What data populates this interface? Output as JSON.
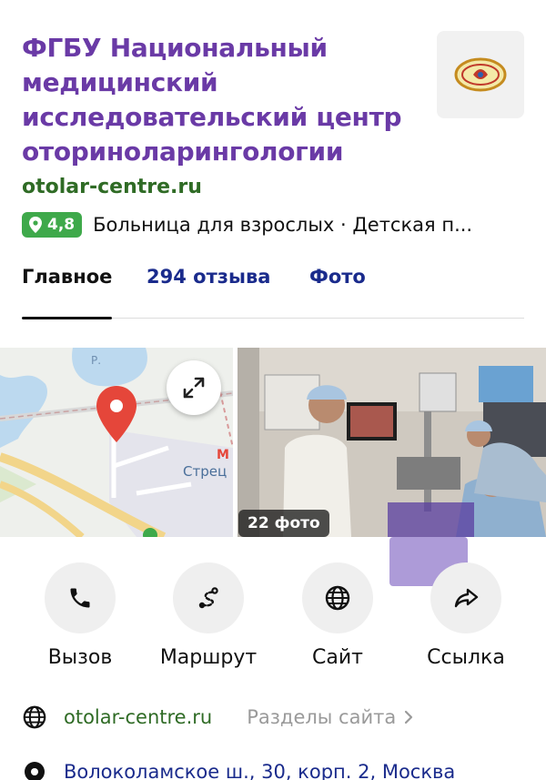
{
  "org": {
    "title_lines": [
      "ФГБУ Национальный",
      "медицинский",
      "исследовательский центр",
      "оториноларингологии"
    ],
    "website": "otolar-centre.ru",
    "rating": "4,8",
    "categories": "Больница для взрослых · Детская п..."
  },
  "tabs": [
    {
      "label": "Главное",
      "active": true
    },
    {
      "label": "294 отзыва",
      "active": false
    },
    {
      "label": "Фото",
      "active": false
    }
  ],
  "map": {
    "street_label": "Стрец"
  },
  "photo": {
    "count_label": "22 фото"
  },
  "actions": [
    {
      "label": "Вызов",
      "icon": "phone-icon"
    },
    {
      "label": "Маршрут",
      "icon": "route-icon"
    },
    {
      "label": "Сайт",
      "icon": "globe-icon"
    },
    {
      "label": "Ссылка",
      "icon": "share-icon"
    }
  ],
  "info": {
    "site": "otolar-centre.ru",
    "sections": "Разделы сайта",
    "address": "Волоколамское ш., 30, корп. 2, Москва"
  },
  "colors": {
    "title": "#6a3aa6",
    "site_green": "#2f6b25",
    "rating_bg": "#3ea94a",
    "tab_link": "#1a2b8c",
    "pin_red": "#e5463a"
  }
}
